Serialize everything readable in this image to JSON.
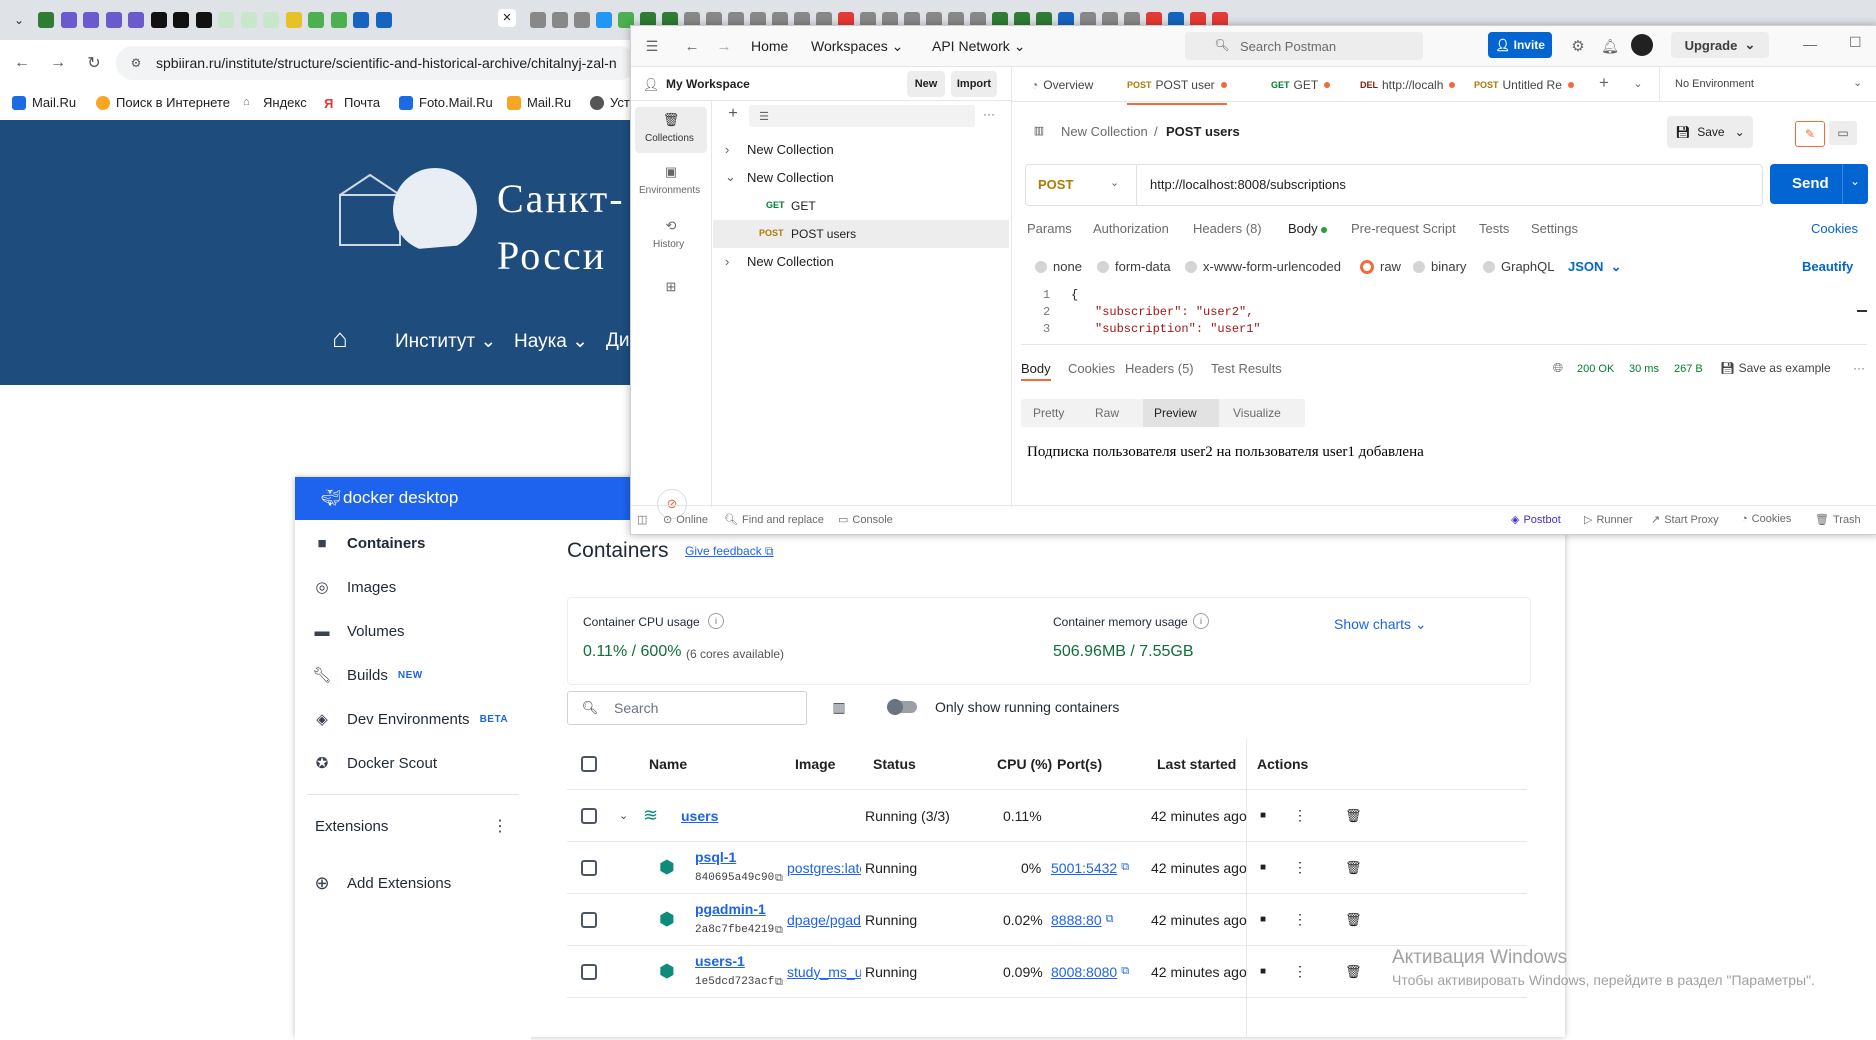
{
  "browser": {
    "url": "spbiiran.ru/institute/structure/scientific-and-historical-archive/chitalnyj-zal-n",
    "close_tab": "×",
    "bookmarks": [
      "Mail.Ru",
      "Поиск в Интернете",
      "Яндекс",
      "Почта",
      "Foto.Mail.Ru",
      "Mail.Ru",
      "Уст"
    ]
  },
  "site": {
    "title_line1": "Санкт-",
    "title_line2": "Росси",
    "nav": [
      "Институт",
      "Наука",
      "Ди"
    ]
  },
  "docker": {
    "brand": "docker desktop",
    "sidebar": [
      {
        "label": "Containers",
        "badge": ""
      },
      {
        "label": "Images",
        "badge": ""
      },
      {
        "label": "Volumes",
        "badge": ""
      },
      {
        "label": "Builds",
        "badge": "NEW"
      },
      {
        "label": "Dev Environments",
        "badge": "BETA"
      },
      {
        "label": "Docker Scout",
        "badge": ""
      }
    ],
    "extensions_label": "Extensions",
    "add_extensions": "Add Extensions",
    "page_title": "Containers",
    "feedback": "Give feedback",
    "cpu_label": "Container CPU usage",
    "cpu_value": "0.11% / 600%",
    "cpu_note": "(6 cores available)",
    "mem_label": "Container memory usage",
    "mem_value": "506.96MB / 7.55GB",
    "show_charts": "Show charts",
    "search_placeholder": "Search",
    "toggle_label": "Only show running containers",
    "columns": [
      "Name",
      "Image",
      "Status",
      "CPU (%)",
      "Port(s)",
      "Last started",
      "Actions"
    ],
    "rows": [
      {
        "name": "users",
        "id": "",
        "image": "",
        "status": "Running (3/3)",
        "cpu": "0.11%",
        "port": "",
        "started": "42 minutes ago"
      },
      {
        "name": "psql-1",
        "id": "840695a49c90",
        "image": "postgres:late",
        "status": "Running",
        "cpu": "0%",
        "port": "5001:5432",
        "started": "42 minutes ago"
      },
      {
        "name": "pgadmin-1",
        "id": "2a8c7fbe4219",
        "image": "dpage/pgadn",
        "status": "Running",
        "cpu": "0.02%",
        "port": "8888:80",
        "started": "42 minutes ago"
      },
      {
        "name": "users-1",
        "id": "1e5dcd723acf",
        "image": "study_ms_us",
        "status": "Running",
        "cpu": "0.09%",
        "port": "8008:8080",
        "started": "42 minutes ago"
      }
    ]
  },
  "postman": {
    "nav": {
      "home": "Home",
      "workspaces": "Workspaces",
      "api_network": "API Network",
      "search": "Search Postman",
      "invite": "Invite",
      "upgrade": "Upgrade"
    },
    "workspace": "My Workspace",
    "new_btn": "New",
    "import_btn": "Import",
    "left_nav": [
      "Collections",
      "Environments",
      "History"
    ],
    "tree": [
      {
        "label": "New Collection",
        "method": ""
      },
      {
        "label": "New Collection",
        "method": ""
      },
      {
        "label": "GET",
        "method": "GET"
      },
      {
        "label": "POST users",
        "method": "POST"
      },
      {
        "label": "New Collection",
        "method": ""
      }
    ],
    "tabs": [
      {
        "label": "Overview",
        "method": ""
      },
      {
        "label": "POST user",
        "method": "POST"
      },
      {
        "label": "GET",
        "method": "GET"
      },
      {
        "label": "http://localh",
        "method": "DEL"
      },
      {
        "label": "Untitled Re",
        "method": "POST"
      }
    ],
    "environment": "No Environment",
    "breadcrumb_collection": "New Collection",
    "breadcrumb_sep": "/",
    "breadcrumb_request": "POST users",
    "save": "Save",
    "method": "POST",
    "url": "http://localhost:8008/subscriptions",
    "send": "Send",
    "req_tabs": [
      "Params",
      "Authorization",
      "Headers (8)",
      "Body",
      "Pre-request Script",
      "Tests",
      "Settings"
    ],
    "cookies": "Cookies",
    "body_types": [
      "none",
      "form-data",
      "x-www-form-urlencoded",
      "raw",
      "binary",
      "GraphQL"
    ],
    "body_format": "JSON",
    "beautify": "Beautify",
    "code_lines": [
      "{",
      "\"subscriber\": \"user2\",",
      "\"subscription\": \"user1\""
    ],
    "line_numbers": [
      "1",
      "2",
      "3"
    ],
    "resp_tabs": [
      "Body",
      "Cookies",
      "Headers (5)",
      "Test Results"
    ],
    "resp_status": "200 OK",
    "resp_time": "30 ms",
    "resp_size": "267 B",
    "save_example": "Save as example",
    "view_modes": [
      "Pretty",
      "Raw",
      "Preview",
      "Visualize"
    ],
    "response_text": "Подписка пользователя user2 на пользователя user1 добавлена",
    "status_bar": {
      "online": "Online",
      "find": "Find and replace",
      "console": "Console",
      "postbot": "Postbot",
      "runner": "Runner",
      "proxy": "Start Proxy",
      "cookies": "Cookies",
      "trash": "Trash"
    }
  },
  "windows_watermark": {
    "title": "Активация Windows",
    "text": "Чтобы активировать Windows, перейдите в раздел \"Параметры\"."
  }
}
